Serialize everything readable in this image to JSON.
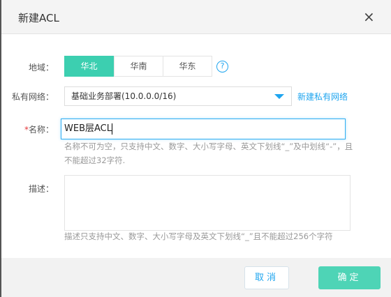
{
  "dialog": {
    "title": "新建ACL",
    "close_icon": "×"
  },
  "region": {
    "label": "地域：",
    "options": [
      "华北",
      "华南",
      "华东"
    ],
    "selected": "华北",
    "help_icon": "?"
  },
  "vpc": {
    "label": "私有网络：",
    "value": "基础业务部署(10.0.0.0/16)",
    "create_link": "新建私有网络"
  },
  "name": {
    "required_mark": "*",
    "label": "名称：",
    "value": "WEB层ACL",
    "hint": "名称不可为空，只支持中文、数字、大小写字母、英文下划线“_”及中划线“-”，且不能超过32字符."
  },
  "description": {
    "label": "描述：",
    "value": "",
    "hint": "描述只支持中文、数字、大小写字母及英文下划线“_”且不能超过256个字符"
  },
  "footer": {
    "cancel": "取消",
    "confirm": "确定"
  },
  "colors": {
    "accent": "#3ccfb0",
    "link": "#1fa5ef"
  }
}
